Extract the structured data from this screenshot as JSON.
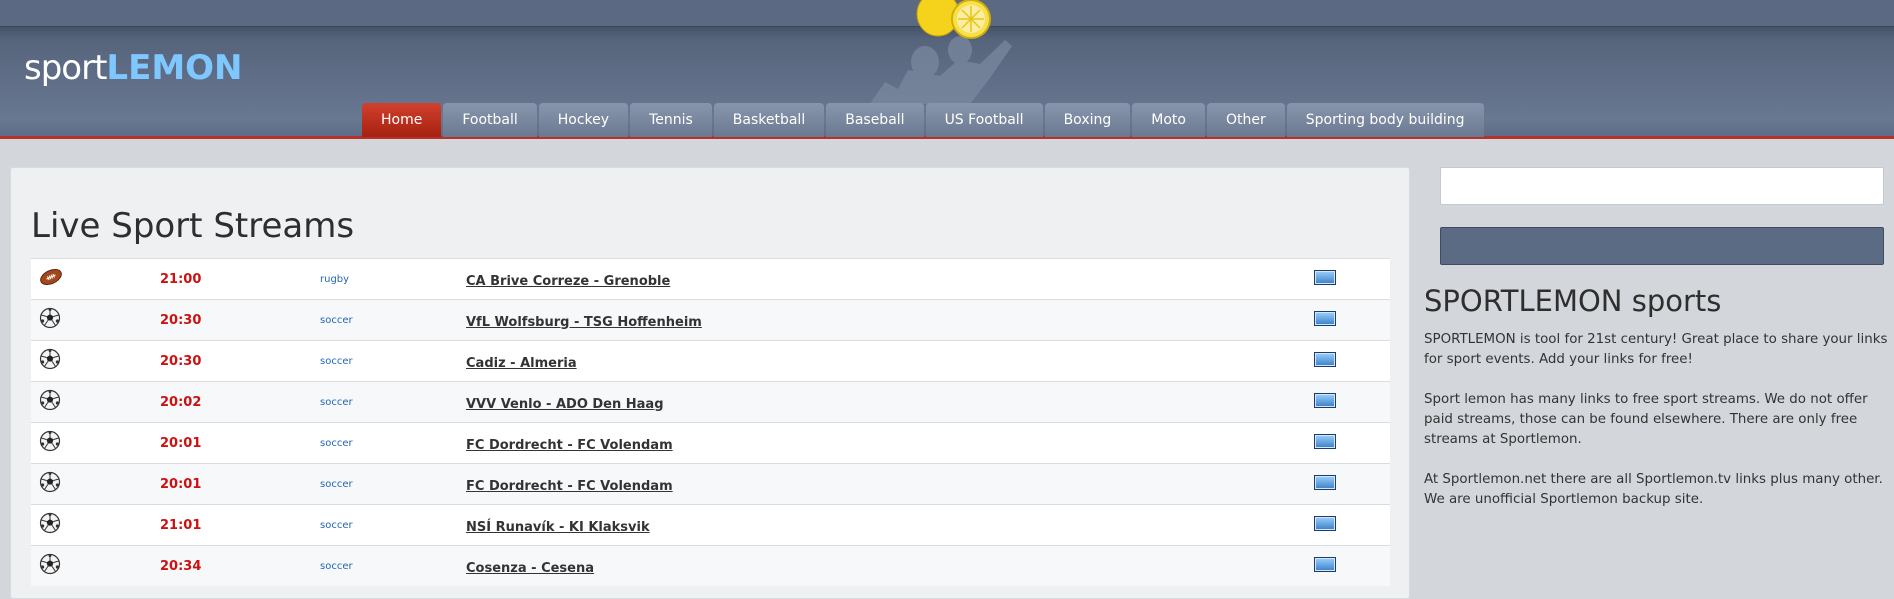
{
  "header": {
    "logo_light": "sport",
    "logo_bold": "LEMON"
  },
  "nav": {
    "items": [
      {
        "label": "Home",
        "active": true
      },
      {
        "label": "Football"
      },
      {
        "label": "Hockey"
      },
      {
        "label": "Tennis"
      },
      {
        "label": "Basketball"
      },
      {
        "label": "Baseball"
      },
      {
        "label": "US Football"
      },
      {
        "label": "Boxing"
      },
      {
        "label": "Moto"
      },
      {
        "label": "Other"
      },
      {
        "label": "Sporting body building"
      }
    ]
  },
  "main": {
    "title": "Live Sport Streams",
    "events": [
      {
        "icon": "rugby-ball-icon",
        "time": "21:00",
        "sport": "rugby",
        "match": "CA Brive Correze - Grenoble"
      },
      {
        "icon": "soccer-ball-icon",
        "time": "20:30",
        "sport": "soccer",
        "match": "VfL Wolfsburg - TSG Hoffenheim"
      },
      {
        "icon": "soccer-ball-icon",
        "time": "20:30",
        "sport": "soccer",
        "match": "Cadiz - Almeria"
      },
      {
        "icon": "soccer-ball-icon",
        "time": "20:02",
        "sport": "soccer",
        "match": "VVV Venlo - ADO Den Haag"
      },
      {
        "icon": "soccer-ball-icon",
        "time": "20:01",
        "sport": "soccer",
        "match": "FC Dordrecht - FC Volendam"
      },
      {
        "icon": "soccer-ball-icon",
        "time": "20:01",
        "sport": "soccer",
        "match": "FC Dordrecht - FC Volendam"
      },
      {
        "icon": "soccer-ball-icon",
        "time": "21:01",
        "sport": "soccer",
        "match": "NSÍ Runavík - KI Klaksvik"
      },
      {
        "icon": "soccer-ball-icon",
        "time": "20:34",
        "sport": "soccer",
        "match": "Cosenza - Cesena"
      }
    ]
  },
  "sidebar": {
    "title": "SPORTLEMON sports",
    "paragraphs": [
      "SPORTLEMON is tool for 21st century! Great place to share your links for sport events. Add your links for free!",
      "Sport lemon has many links to free sport streams. We do not offer paid streams, those can be found elsewhere. There are only free streams at Sportlemon.",
      "At Sportlemon.net there are all Sportlemon.tv links plus many other. We are unofficial Sportlemon backup site."
    ]
  },
  "colors": {
    "header": "#5e6d86",
    "nav_active": "#b5281a",
    "time": "#cc1111",
    "sport": "#2466b5",
    "logo_accent": "#7fc8ff"
  }
}
